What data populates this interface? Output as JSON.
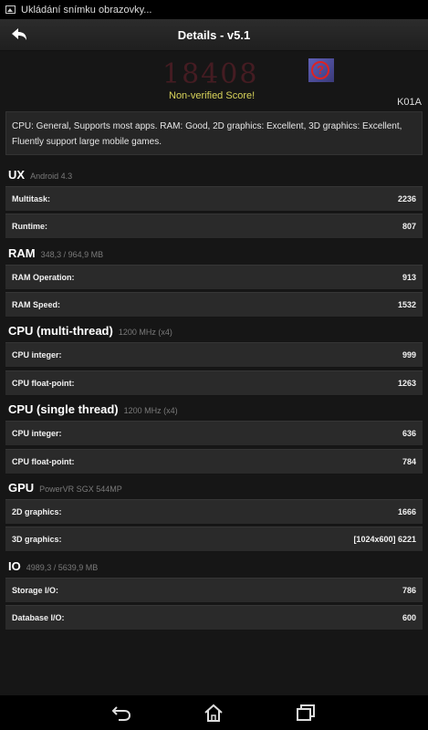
{
  "status_bar": {
    "notification_text": "Ukládání snímku obrazovky..."
  },
  "action_bar": {
    "title": "Details - v5.1"
  },
  "hero": {
    "score_ghost": "18408",
    "non_verified": "Non-verified Score!",
    "help_glyph": "?",
    "model": "K01A"
  },
  "description": "CPU: General, Supports most apps. RAM: Good, 2D graphics: Excellent, 3D graphics: Excellent, Fluently support large mobile games.",
  "sections": [
    {
      "name": "UX",
      "sub": "Android 4.3",
      "rows": [
        {
          "label": "Multitask:",
          "value": "2236"
        },
        {
          "label": "Runtime:",
          "value": "807"
        }
      ]
    },
    {
      "name": "RAM",
      "sub": "348,3 / 964,9 MB",
      "rows": [
        {
          "label": "RAM Operation:",
          "value": "913"
        },
        {
          "label": "RAM Speed:",
          "value": "1532"
        }
      ]
    },
    {
      "name": "CPU (multi-thread)",
      "sub": "1200 MHz (x4)",
      "rows": [
        {
          "label": "CPU integer:",
          "value": "999"
        },
        {
          "label": "CPU float-point:",
          "value": "1263"
        }
      ]
    },
    {
      "name": "CPU (single thread)",
      "sub": "1200 MHz (x4)",
      "rows": [
        {
          "label": "CPU integer:",
          "value": "636"
        },
        {
          "label": "CPU float-point:",
          "value": "784"
        }
      ]
    },
    {
      "name": "GPU",
      "sub": "PowerVR SGX 544MP",
      "rows": [
        {
          "label": "2D graphics:",
          "value": "1666"
        },
        {
          "label": "3D graphics:",
          "value": "[1024x600] 6221"
        }
      ]
    },
    {
      "name": "IO",
      "sub": "4989,3 / 5639,9 MB",
      "rows": [
        {
          "label": "Storage I/O:",
          "value": "786"
        },
        {
          "label": "Database I/O:",
          "value": "600"
        }
      ]
    }
  ],
  "icons": {
    "status": "image-icon",
    "back": "back-arrow-icon",
    "help": "help-icon",
    "nav": [
      "nav-back-icon",
      "nav-home-icon",
      "nav-recents-icon"
    ]
  },
  "colors": {
    "non_verified": "#d8d35a",
    "help_ring": "#dd2222",
    "row_bg": "#2a2a2a",
    "background": "#161616"
  }
}
